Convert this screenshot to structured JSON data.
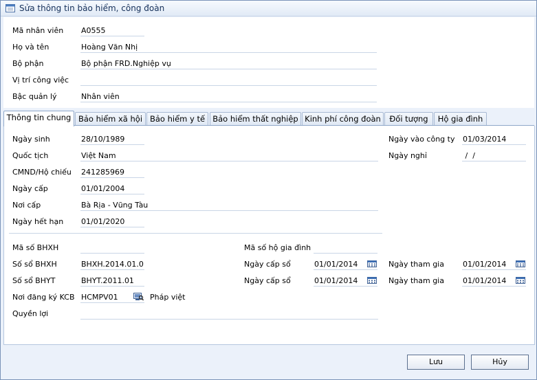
{
  "window": {
    "title": "Sửa thông tin bảo hiểm, công đoàn"
  },
  "employee": {
    "code_label": "Mã nhân viên",
    "code_value": "A0555",
    "name_label": "Họ và tên",
    "name_value": "Hoàng Văn Nhị",
    "dept_label": "Bộ phận",
    "dept_value": "Bộ phận FRD.Nghiệp vụ",
    "position_label": "Vị trí công việc",
    "position_value": "",
    "level_label": "Bậc quản lý",
    "level_value": "Nhân viên"
  },
  "tabs": [
    {
      "label": "Thông tin chung"
    },
    {
      "label": "Bảo hiểm xã hội"
    },
    {
      "label": "Bảo hiểm y tế"
    },
    {
      "label": "Bảo hiểm thất nghiệp"
    },
    {
      "label": "Kinh phí công đoàn"
    },
    {
      "label": "Đối tượng"
    },
    {
      "label": "Hộ gia đình"
    }
  ],
  "general": {
    "dob_label": "Ngày sinh",
    "dob_value": "28/10/1989",
    "nationality_label": "Quốc tịch",
    "nationality_value": "Việt Nam",
    "id_label": "CMND/Hộ chiếu",
    "id_value": "241285969",
    "issue_date_label": "Ngày cấp",
    "issue_date_value": "01/01/2004",
    "issue_place_label": "Nơi cấp",
    "issue_place_value": "Bà Rịa - Vũng Tàu",
    "expiry_label": "Ngày hết hạn",
    "expiry_value": "01/01/2020",
    "join_date_label": "Ngày vào công ty",
    "join_date_value": "01/03/2014",
    "leave_date_label": "Ngày nghỉ",
    "leave_date_value": " /  /"
  },
  "insurance": {
    "bhxh_code_label": "Mã số BHXH",
    "bhxh_code_value": "",
    "household_code_label": "Mã số hộ gia đình",
    "household_code_value": "",
    "bhxh_book_label": "Số sổ BHXH",
    "bhxh_book_value": "BHXH.2014.01.0",
    "bhxh_issue_label": "Ngày cấp sổ",
    "bhxh_issue_value": "01/01/2014",
    "bhxh_join_label": "Ngày tham gia",
    "bhxh_join_value": "01/01/2014",
    "bhyt_book_label": "Số sổ BHYT",
    "bhyt_book_value": "BHYT.2011.01",
    "bhyt_issue_label": "Ngày cấp sổ",
    "bhyt_issue_value": "01/01/2014",
    "bhyt_join_label": "Ngày tham gia",
    "bhyt_join_value": "01/01/2014",
    "kcb_label": "Nơi đăng ký KCB",
    "kcb_code": "HCMPV01",
    "kcb_name": "Pháp việt",
    "rights_label": "Quyền lợi",
    "rights_value": ""
  },
  "buttons": {
    "save": "Lưu",
    "cancel": "Hủy"
  }
}
